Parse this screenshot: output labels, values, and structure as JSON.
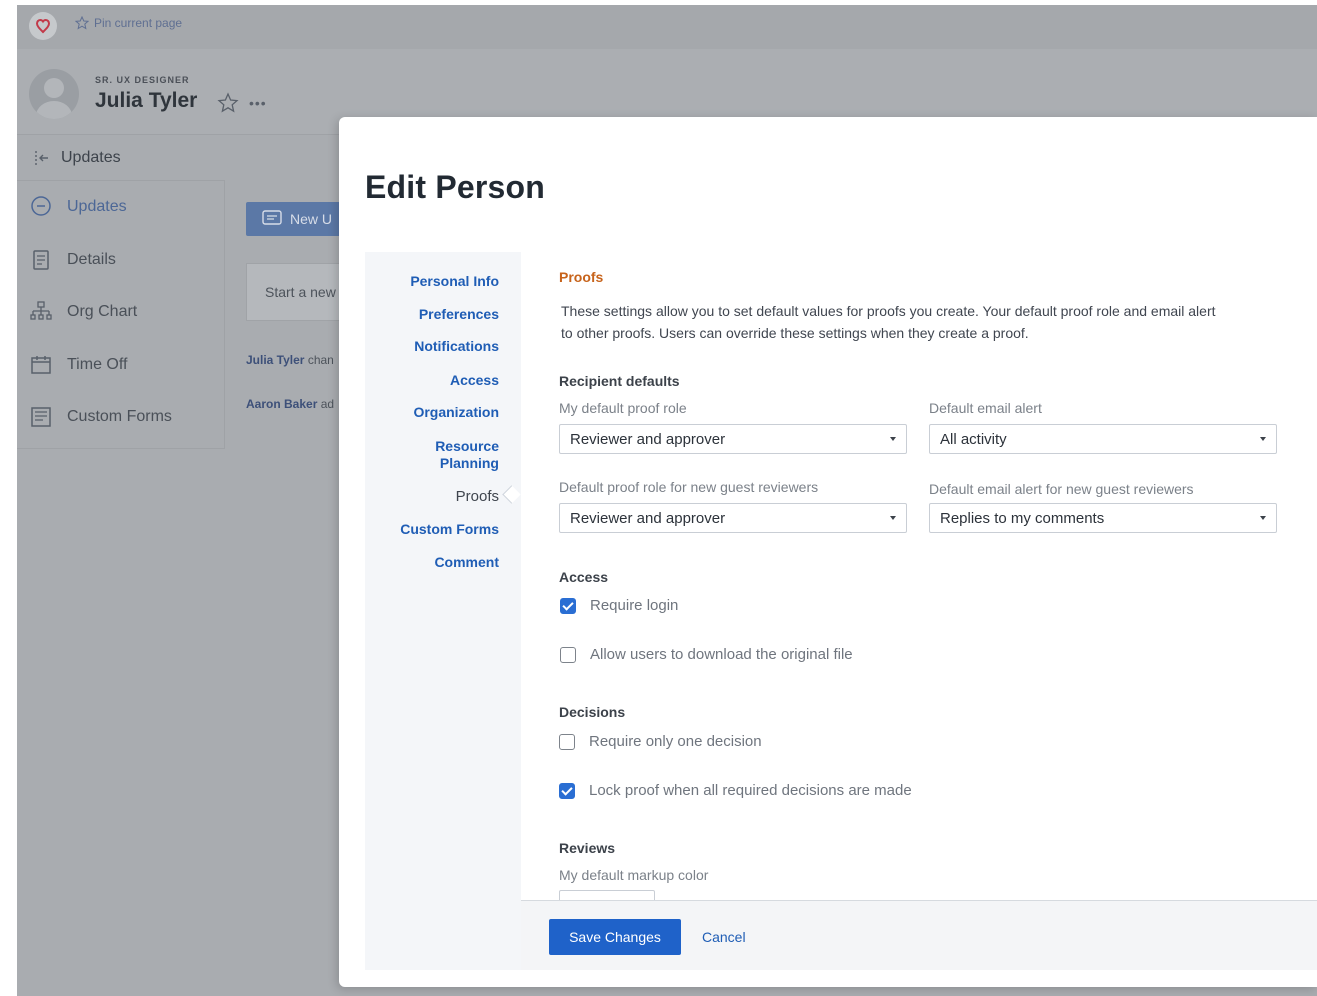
{
  "topbar": {
    "pin_label": "Pin current page"
  },
  "person": {
    "role": "SR. UX DESIGNER",
    "name": "Julia Tyler",
    "more": "•••"
  },
  "leftnav": {
    "header": "Updates",
    "items": [
      {
        "label": "Updates",
        "icon": "chat-bubble-icon",
        "active": true
      },
      {
        "label": "Details",
        "icon": "document-icon"
      },
      {
        "label": "Org Chart",
        "icon": "org-chart-icon"
      },
      {
        "label": "Time Off",
        "icon": "calendar-icon"
      },
      {
        "label": "Custom Forms",
        "icon": "forms-icon"
      }
    ]
  },
  "feed": {
    "new_button": "New U",
    "input_placeholder": "Start a new",
    "lines": [
      {
        "who": "Julia Tyler",
        "rest": " chan"
      },
      {
        "who": "Aaron Baker",
        "rest": " ad"
      }
    ]
  },
  "modal": {
    "title": "Edit Person",
    "subnav": [
      "Personal Info",
      "Preferences",
      "Notifications",
      "Access",
      "Organization",
      "Resource\nPlanning",
      "Proofs",
      "Custom Forms",
      "Comment"
    ],
    "active_subnav": "Proofs",
    "section_title": "Proofs",
    "description_line1": "These settings allow you to set default values for proofs you create. Your default proof role and email alert",
    "description_line2": "to other proofs. Users can override these settings when they create a proof.",
    "recipient_defaults": {
      "heading": "Recipient defaults",
      "proof_role_label": "My default proof role",
      "proof_role_value": "Reviewer and approver",
      "email_alert_label": "Default email alert",
      "email_alert_value": "All activity",
      "guest_role_label": "Default proof role for new guest reviewers",
      "guest_role_value": "Reviewer and approver",
      "guest_alert_label": "Default email alert for new guest reviewers",
      "guest_alert_value": "Replies to my comments"
    },
    "access": {
      "heading": "Access",
      "require_login": "Require login",
      "require_login_checked": true,
      "allow_download": "Allow users to download the original file",
      "allow_download_checked": false
    },
    "decisions": {
      "heading": "Decisions",
      "one_decision": "Require only one decision",
      "one_decision_checked": false,
      "lock_proof": "Lock proof when all required decisions are made",
      "lock_proof_checked": true
    },
    "reviews": {
      "heading": "Reviews",
      "markup_color_label": "My default markup color"
    },
    "footer": {
      "save": "Save Changes",
      "cancel": "Cancel"
    }
  },
  "colors": {
    "primary": "#1f62c9",
    "link": "#1f5db5",
    "section": "#c7631b",
    "overlay": "#a9acb0"
  }
}
